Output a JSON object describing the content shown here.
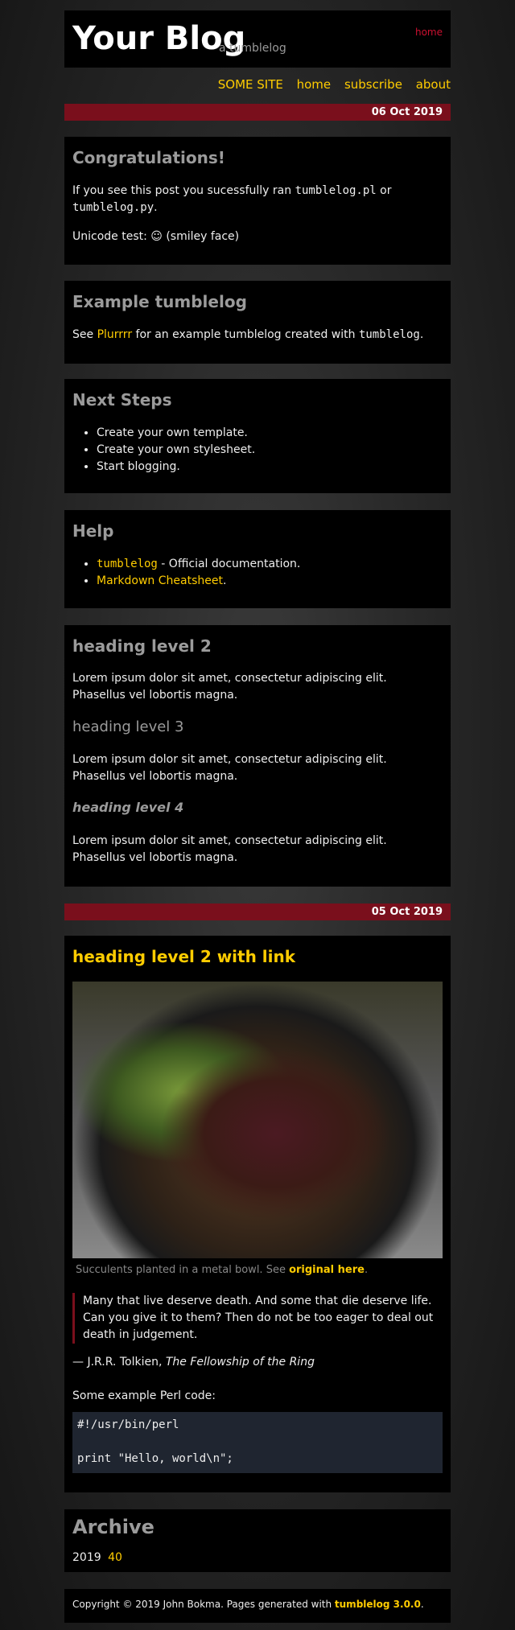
{
  "header": {
    "title": "Your Blog",
    "tagline": "a tumblelog",
    "home_link": "home"
  },
  "nav": {
    "items": [
      "SOME SITE",
      "home",
      "subscribe",
      "about"
    ]
  },
  "dates": [
    "06 Oct 2019",
    "05 Oct 2019"
  ],
  "posts": {
    "congrats": {
      "title": "Congratulations!",
      "p1_before": "If you see this post you sucessfully ran ",
      "p1_code1": "tumblelog.pl",
      "p1_mid": " or",
      "p1_code2": "tumblelog.py",
      "p1_after": ".",
      "p2": "Unicode test: ☺ (smiley face)"
    },
    "example": {
      "title": "Example tumblelog",
      "before": "See ",
      "link": "Plurrrr",
      "mid": " for an example tumblelog created with ",
      "code": "tumblelog",
      "after": "."
    },
    "next_steps": {
      "title": "Next Steps",
      "items": [
        "Create your own template.",
        "Create your own stylesheet.",
        "Start blogging."
      ]
    },
    "help": {
      "title": "Help",
      "item1_link": "tumblelog",
      "item1_text": " - Official documentation.",
      "item2_link": "Markdown Cheatsheet",
      "item2_text": "."
    },
    "headings": {
      "h2": "heading level 2",
      "h3": "heading level 3",
      "h4": "heading level 4",
      "lorem": "Lorem ipsum dolor sit amet, consectetur adipiscing elit. Phasellus vel lobortis magna."
    },
    "link_post": {
      "title": "heading level 2 with link",
      "image_alt": "Succulents planted in a metal bowl",
      "caption_text": "Succulents planted in a metal bowl. See ",
      "caption_link": "original here",
      "caption_after": ".",
      "quote": "Many that live deserve death. And some that die deserve life. Can you give it to them? Then do not be too eager to deal out death in judgement.",
      "attribution_prefix": "— J.R.R. Tolkien, ",
      "attribution_work": "The Fellowship of the Ring",
      "code_intro": "Some example Perl code:",
      "code": "#!/usr/bin/perl\n\nprint \"Hello, world\\n\";"
    }
  },
  "archive": {
    "title": "Archive",
    "year": "2019",
    "week": "40"
  },
  "footer": {
    "text": "Copyright © 2019 John Bokma. Pages generated with ",
    "link": "tumblelog 3.0.0",
    "after": "."
  }
}
